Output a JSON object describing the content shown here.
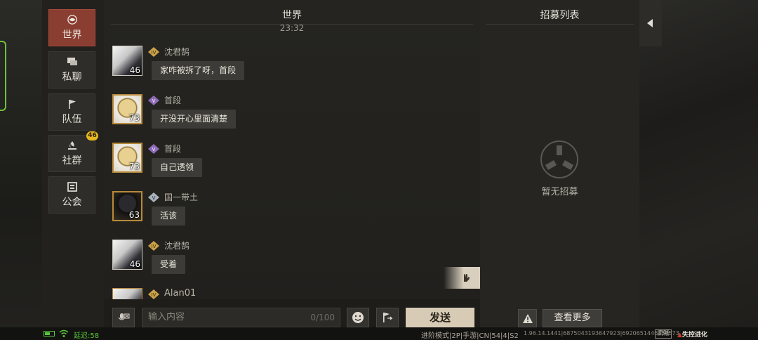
{
  "sidebar": {
    "items": [
      {
        "label": "世界",
        "active": true
      },
      {
        "label": "私聊",
        "active": false
      },
      {
        "label": "队伍",
        "active": false
      },
      {
        "label": "社群",
        "active": false,
        "badge": "46"
      },
      {
        "label": "公会",
        "active": false
      }
    ]
  },
  "chat": {
    "title": "世界",
    "time": "23:32",
    "messages": [
      {
        "name": "沈君鹄",
        "level": "46",
        "text": "家咋被拆了呀，首段"
      },
      {
        "name": "首段",
        "level": "73",
        "text": "开没开心里面清楚"
      },
      {
        "name": "首段",
        "level": "73",
        "text": "自己透领"
      },
      {
        "name": "国一带土",
        "level": "63",
        "text": "活该"
      },
      {
        "name": "沈君鹄",
        "level": "46",
        "text": "受着"
      },
      {
        "name": "Alan01",
        "level": "",
        "text": ""
      }
    ],
    "input_placeholder": "输入内容",
    "input_count": "0/100",
    "send_label": "发送"
  },
  "recruit": {
    "title": "招募列表",
    "empty_text": "暂无招募",
    "more_label": "查看更多"
  },
  "status": {
    "latency": "延迟:58",
    "mode": "进阶模式|2P|手游|CN|54|4|S2",
    "build": "1.96.14.1441|6875043193647923|6920651446858573",
    "smooth": "流畅",
    "logo": "失控进化"
  },
  "colors": {
    "active_tab": "#8a3d31",
    "badge": "#e8b622",
    "send_button": "#d8cbb6",
    "latency_green": "#58c63d"
  }
}
